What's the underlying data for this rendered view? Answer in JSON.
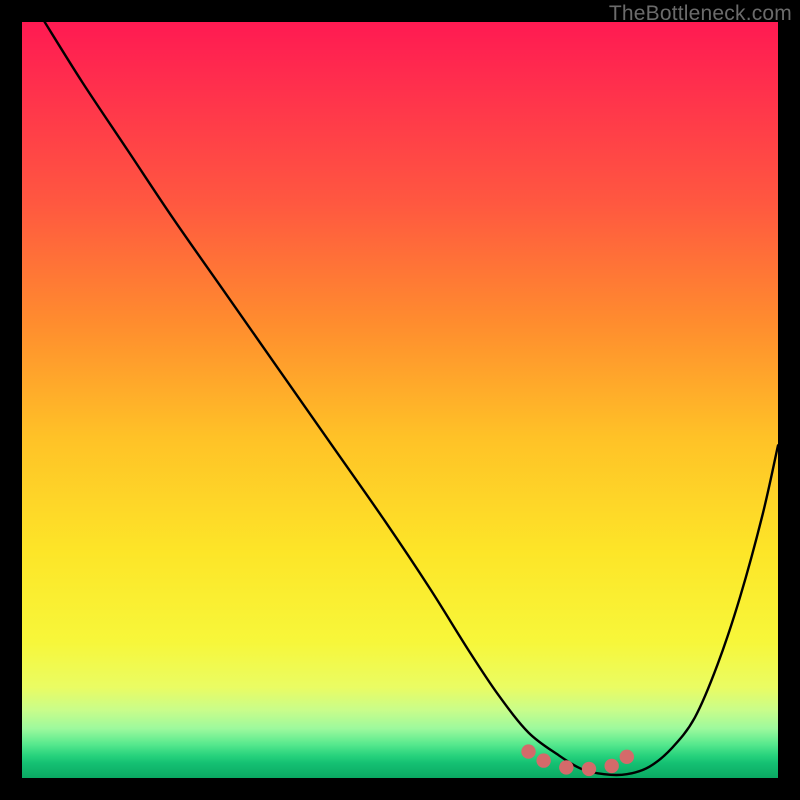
{
  "watermark": {
    "text": "TheBottleneck.com"
  },
  "colors": {
    "page_bg": "#000000",
    "curve": "#000000",
    "marker_fill": "#d46a6a",
    "marker_stroke": "#b24f4f"
  },
  "chart_data": {
    "type": "line",
    "title": "",
    "xlabel": "",
    "ylabel": "",
    "xlim": [
      0,
      100
    ],
    "ylim": [
      0,
      100
    ],
    "grid": false,
    "series": [
      {
        "name": "bottleneck-curve",
        "x": [
          3,
          8,
          14,
          20,
          27,
          34,
          41,
          48,
          54,
          59,
          63,
          67,
          71,
          74,
          77,
          80,
          83,
          86,
          89,
          92,
          95,
          98,
          100
        ],
        "y": [
          100,
          92,
          83,
          74,
          64,
          54,
          44,
          34,
          25,
          17,
          11,
          6,
          3,
          1.2,
          0.5,
          0.5,
          1.5,
          4,
          8,
          15,
          24,
          35,
          44
        ]
      }
    ],
    "markers": {
      "name": "valley-markers",
      "x": [
        67,
        69,
        72,
        75,
        78,
        80
      ],
      "y": [
        3.5,
        2.3,
        1.4,
        1.2,
        1.6,
        2.8
      ]
    }
  }
}
